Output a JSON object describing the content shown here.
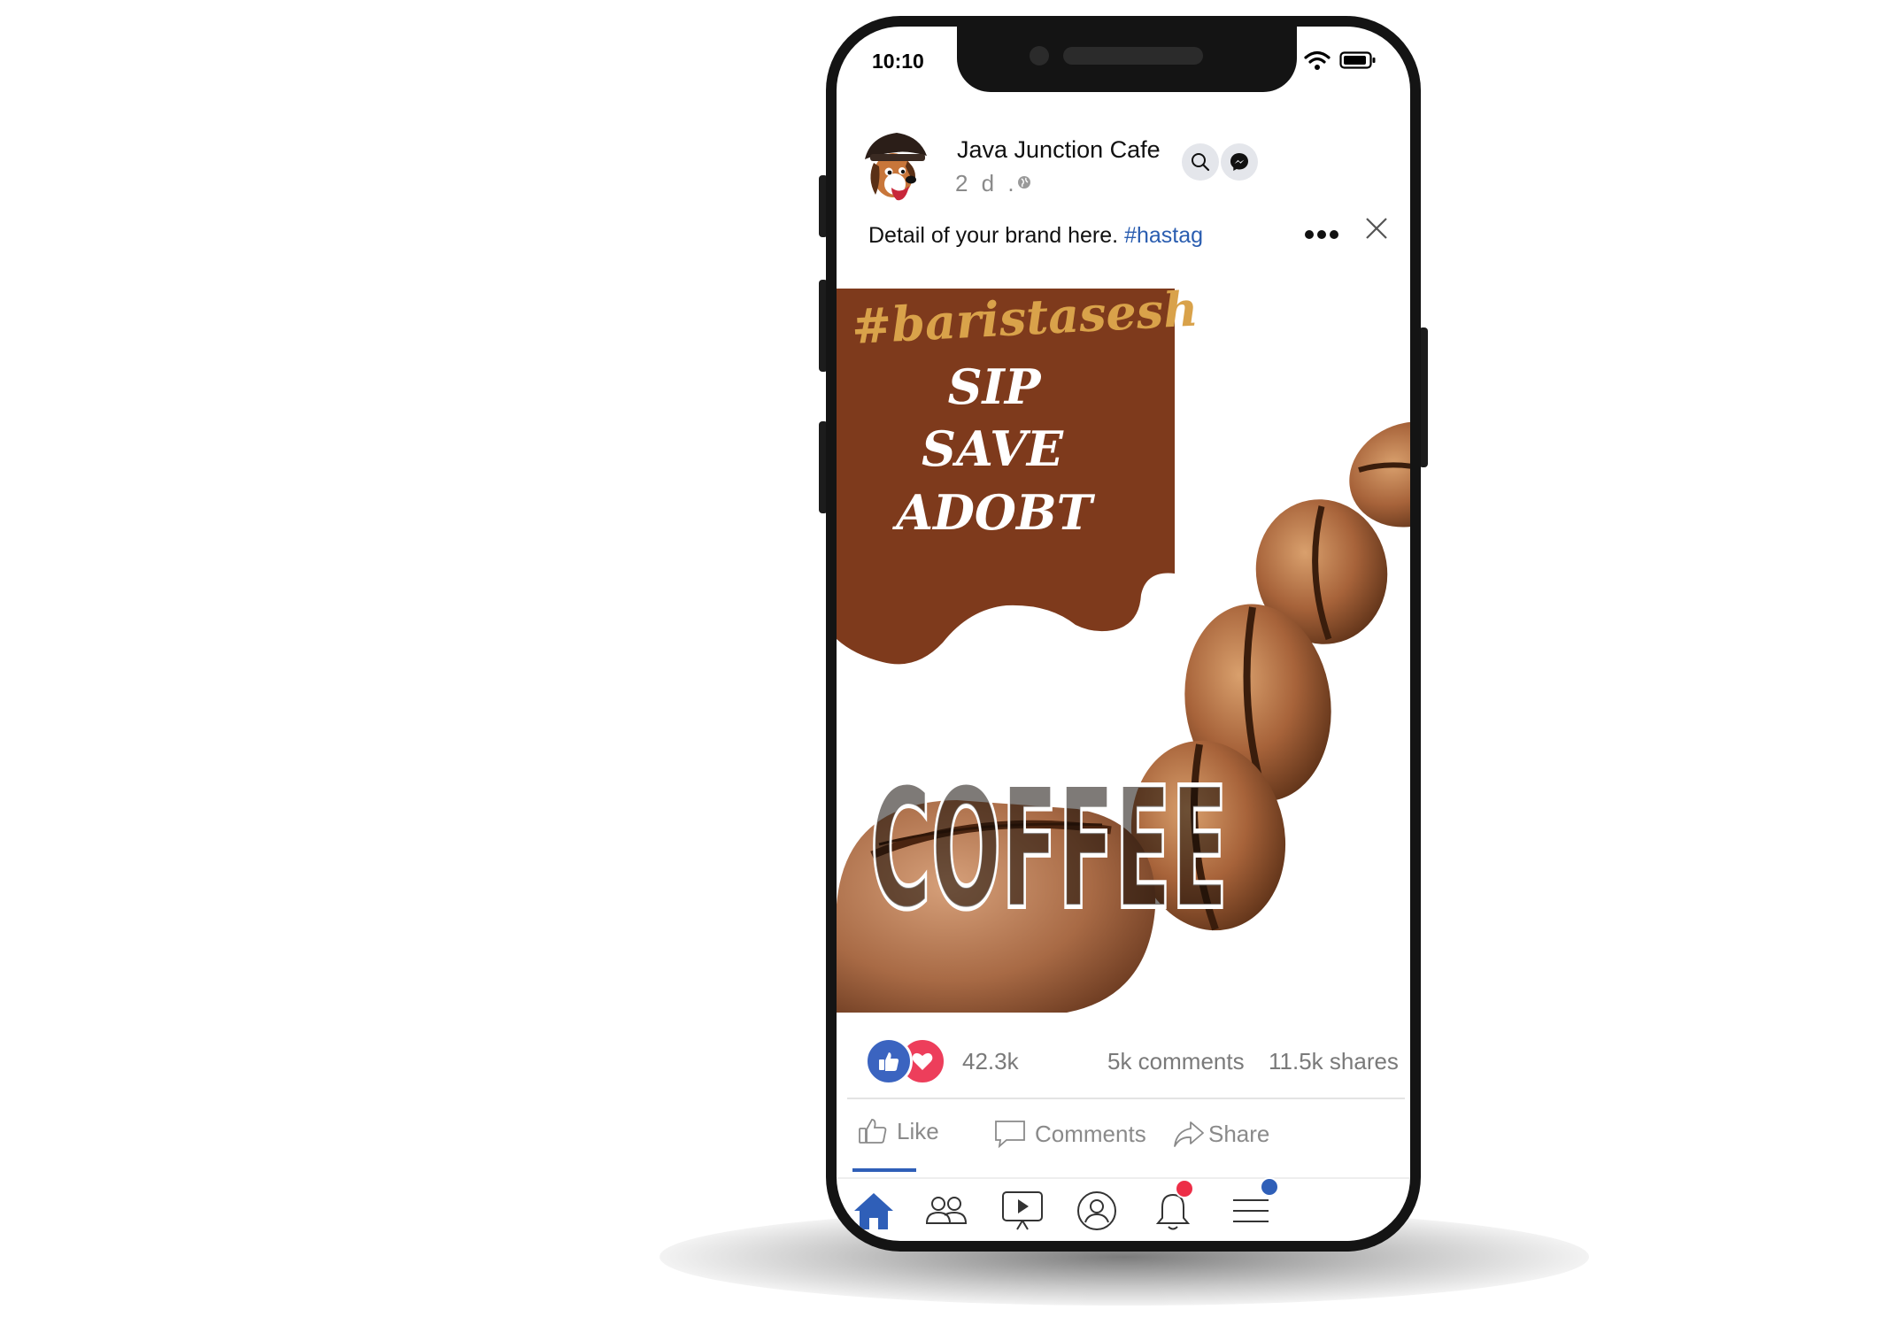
{
  "status_bar": {
    "time": "10:10",
    "icons": [
      "wifi-icon",
      "battery-icon"
    ]
  },
  "post": {
    "page_name": "Java Junction Cafe",
    "timestamp": "2 d .",
    "privacy_icon": "globe-icon",
    "caption_text": "Detail of your brand here.",
    "caption_hashtag": "#hastag",
    "header_icons": [
      "search-icon",
      "messenger-icon",
      "more-options-icon",
      "close-icon"
    ]
  },
  "image": {
    "hashtag": "#baristasesh",
    "lines": [
      "SIP",
      "SAVE",
      "ADOBT"
    ],
    "headline": "COFFEE"
  },
  "stats": {
    "reactions": "42.3k",
    "comments": "5k comments",
    "shares": "11.5k shares"
  },
  "actions": {
    "like": "Like",
    "comments": "Comments",
    "share": "Share"
  },
  "bottom_nav": [
    "home-icon",
    "friends-icon",
    "watch-icon",
    "profile-icon",
    "notifications-icon",
    "menu-icon"
  ],
  "colors": {
    "accent": "#2f5fb8",
    "like_blue": "#3b64c0",
    "love_red": "#ed3e5b",
    "banner_brown": "#7e3a1c",
    "hashtag_gold": "#d9a24a",
    "notification_badge": "#ed2e47",
    "menu_badge": "#2f5fb8"
  }
}
